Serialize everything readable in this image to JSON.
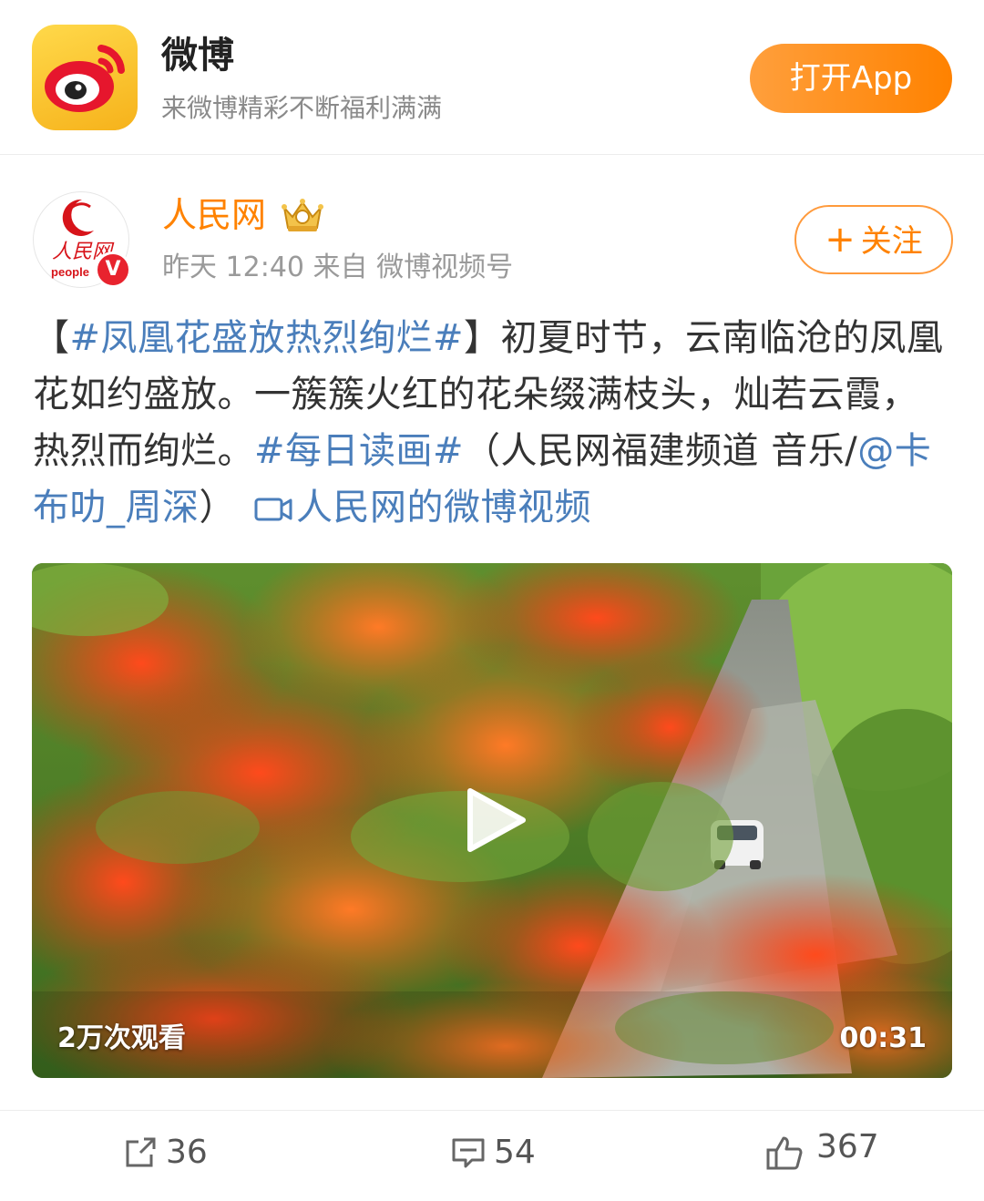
{
  "banner": {
    "app_name": "微博",
    "slogan": "来微博精彩不断福利满满",
    "open_app_label": "打开App",
    "icon": "weibo-logo-icon",
    "colors": {
      "accent": "#ff8200",
      "icon_bg": "#f6b21b"
    }
  },
  "post": {
    "author": {
      "name": "人民网",
      "avatar_text": "人民网",
      "avatar_sub": "people",
      "verified_badge": "V",
      "badge_icon": "crown-icon"
    },
    "meta": "昨天 12:40 来自 微博视频号",
    "follow_label": "关注",
    "follow_icon": "plus-icon",
    "text": {
      "bracket_open": "【",
      "hashtag_1": "#凤凰花盛放热烈绚烂#",
      "bracket_close": "】",
      "body_1": "初夏时节，云南临沧的凤凰花如约盛放。一簇簇火红的花朵缀满枝头，灿若云霞，热烈而绚烂。",
      "hashtag_2": "#每日读画#",
      "body_2": "（人民网福建频道 音乐/",
      "mention": "@卡布叻_周深",
      "body_3": "）",
      "video_link": "人民网的微博视频",
      "link_color": "#4a7ebb"
    },
    "video": {
      "views": "2万次观看",
      "duration": "00:31",
      "play_icon": "play-icon"
    },
    "actions": {
      "repost_count": "36",
      "comment_count": "54",
      "like_count": "367"
    }
  }
}
